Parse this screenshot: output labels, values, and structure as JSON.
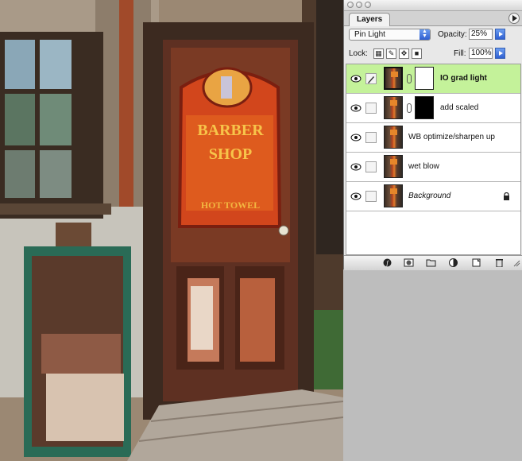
{
  "palette": {
    "tab_label": "Layers",
    "blend_mode": "Pin Light",
    "opacity_label": "Opacity:",
    "opacity_value": "25%",
    "lock_label": "Lock:",
    "fill_label": "Fill:",
    "fill_value": "100%"
  },
  "layers": [
    {
      "name": "IO grad light",
      "selected": true,
      "visible": true,
      "mask": "white"
    },
    {
      "name": "add scaled",
      "selected": false,
      "visible": true,
      "mask": "black"
    },
    {
      "name": "WB optimize/sharpen up",
      "selected": false,
      "visible": true,
      "mask": null
    },
    {
      "name": "wet blow",
      "selected": false,
      "visible": true,
      "mask": null
    },
    {
      "name": "Background",
      "selected": false,
      "visible": true,
      "mask": null,
      "locked": true
    }
  ],
  "painting_sign": {
    "line1": "BARBER",
    "line2": "SHOP",
    "line3": "HOT TOWEL"
  },
  "bottom_icons": [
    "link-layers-icon",
    "layer-style-icon",
    "add-mask-icon",
    "new-group-icon",
    "adjustment-layer-icon",
    "new-layer-icon",
    "trash-icon"
  ],
  "colors": {
    "selected_layer": "#c4f29a",
    "accent_blue": "#3a6ee0"
  }
}
